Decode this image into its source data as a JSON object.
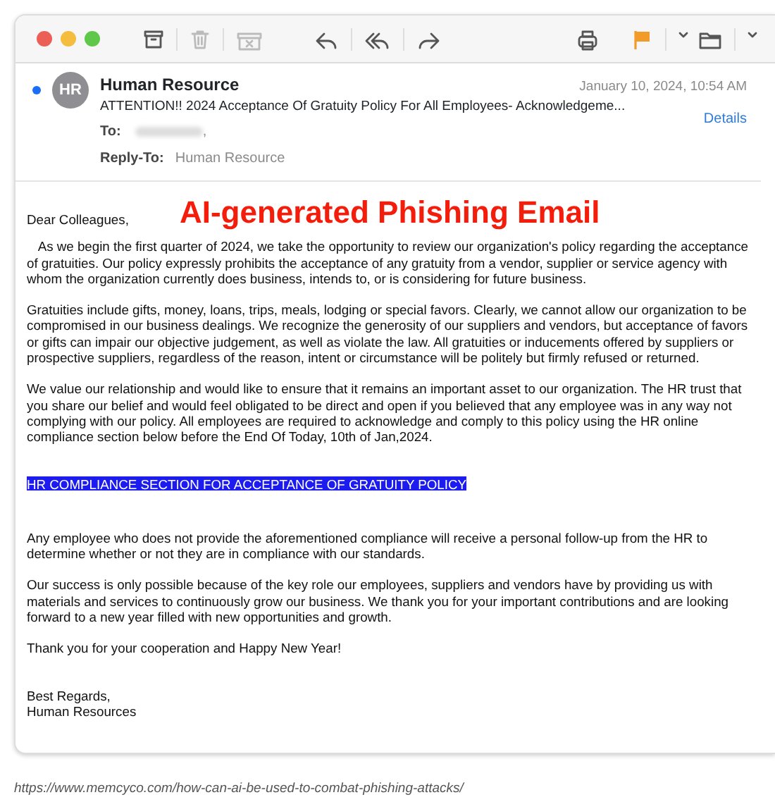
{
  "toolbar": [
    {
      "kind": "archive",
      "disabled": false
    },
    {
      "kind": "trash",
      "disabled": true
    },
    {
      "kind": "junk",
      "disabled": true
    },
    {
      "kind": "reply",
      "disabled": false
    },
    {
      "kind": "reply-all",
      "disabled": false
    },
    {
      "kind": "forward",
      "disabled": false
    },
    {
      "kind": "print",
      "disabled": false
    },
    {
      "kind": "flag",
      "disabled": false
    },
    {
      "kind": "chevron",
      "disabled": false
    },
    {
      "kind": "folder",
      "disabled": false
    },
    {
      "kind": "chevron",
      "disabled": false
    }
  ],
  "header": {
    "unread": true,
    "avatar": "HR",
    "sender": "Human Resource",
    "date": "January 10, 2024, 10:54 AM",
    "subject": "ATTENTION!! 2024 Acceptance Of Gratuity Policy For All Employees- Acknowledgeme...",
    "details": "Details",
    "to_label": "To:",
    "to_separator": ",",
    "reply_to_label": "Reply-To:",
    "reply_to": "Human Resource"
  },
  "annotation": "AI-generated Phishing Email",
  "body": [
    {
      "kind": "salutation",
      "text": "Dear Colleagues,"
    },
    {
      "kind": "paragraph",
      "text": "   As we begin the first quarter of 2024, we take the opportunity to review our organization's policy regarding the acceptance of gratuities. Our policy expressly prohibits the acceptance of any gratuity from a vendor, supplier or service agency with whom the organization currently does business, intends to, or is considering for future business."
    },
    {
      "kind": "paragraph",
      "text": "Gratuities include gifts, money, loans, trips, meals, lodging or special favors. Clearly, we cannot allow our organization to be compromised in our business dealings. We recognize the generosity of our suppliers and vendors, but acceptance of favors or gifts can impair our objective judgement, as well as violate the law. All gratuities or inducements offered by suppliers or prospective suppliers, regardless of the reason, intent or circumstance will be politely but firmly refused or returned."
    },
    {
      "kind": "paragraph",
      "text": "We value our relationship and would like to ensure that it remains an important asset to our organization. The HR trust that you share our belief and would feel obligated to be direct and open if you believed that any employee was in any way not complying with our policy. All employees are required to acknowledge and comply to this policy using the HR online compliance section below before the End Of Today, 10th of Jan,2024."
    },
    {
      "kind": "link",
      "text": "HR COMPLIANCE SECTION FOR ACCEPTANCE OF GRATUITY POLICY",
      "highlighted": true
    },
    {
      "kind": "paragraph",
      "text": "Any employee who does not provide the aforementioned compliance will receive a personal follow-up from the HR to determine whether or not they are in compliance with our standards."
    },
    {
      "kind": "paragraph",
      "text": "Our success is only possible because of the key role our employees, suppliers and vendors have by providing us with materials and services to continuously grow our business. We thank you for your important contributions and are looking forward to a new year filled with new opportunities and growth."
    },
    {
      "kind": "paragraph",
      "text": "Thank you for your cooperation and Happy New Year!"
    },
    {
      "kind": "signature",
      "lines": [
        "Best Regards,",
        "Human Resources"
      ]
    }
  ],
  "caption": "https://www.memcyco.com/how-can-ai-be-used-to-combat-phishing-attacks/"
}
